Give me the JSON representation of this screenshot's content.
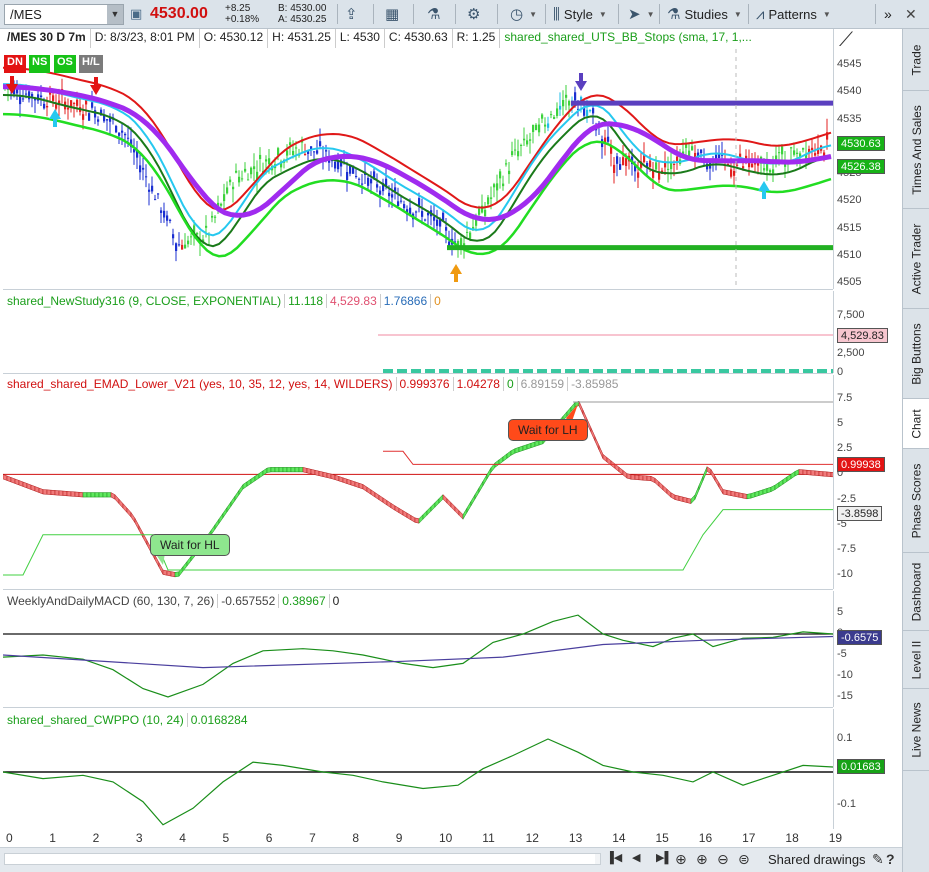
{
  "toolbar": {
    "symbol": "/MES",
    "last_price": "4530.00",
    "change": "+8.25",
    "change_pct": "+0.18%",
    "bid": "B: 4530.00",
    "ask": "A: 4530.25",
    "style_label": "Style",
    "studies_label": "Studies",
    "patterns_label": "Patterns"
  },
  "right_tabs": [
    "Trade",
    "Times And Sales",
    "Active Trader",
    "Big Buttons",
    "Chart",
    "Phase Scores",
    "Dashboard",
    "Level II",
    "Live News"
  ],
  "price_pane": {
    "header": [
      "/MES 30 D 7m",
      "D: 8/3/23, 8:01 PM",
      "O: 4530.12",
      "H: 4531.25",
      "L: 4530",
      "C: 4530.63",
      "R: 1.25",
      "shared_shared_UTS_BB_Stops (sma, 17, 1,..."
    ],
    "badges": [
      {
        "text": "DN",
        "color": "#e31313"
      },
      {
        "text": "NS",
        "color": "#17c217"
      },
      {
        "text": "OS",
        "color": "#17c217"
      },
      {
        "text": "H/L",
        "color": "#7b7b7b"
      }
    ],
    "ticks": [
      "4545",
      "4540",
      "4535",
      "4530",
      "4525",
      "4520",
      "4515",
      "4510",
      "4505"
    ],
    "price_labels": [
      {
        "text": "4530.63",
        "color": "#17b217",
        "value": 4530.63
      },
      {
        "text": "4526.38",
        "color": "#17b217",
        "value": 4526.38
      }
    ]
  },
  "study1": {
    "header": [
      "shared_NewStudy316 (9, CLOSE, EXPONENTIAL)",
      "11.118",
      "4,529.83",
      "1.76866",
      "0"
    ],
    "header_colors": [
      "#1a9e1a",
      "#1a9e1a",
      "#e05070",
      "#2a6db8",
      "#e09020"
    ],
    "ticks": [
      "7,500",
      "5,000",
      "2,500",
      "0"
    ],
    "label": {
      "text": "4,529.83",
      "color": "#f7c6cf",
      "value": 4529.83
    }
  },
  "study2": {
    "header": [
      "shared_shared_EMAD_Lower_V21 (yes, 10, 35, 12, yes, 14, WILDERS)",
      "0.999376",
      "1.04278",
      "0",
      "6.89159",
      "-3.85985"
    ],
    "header_colors": [
      "#d11010",
      "#d11010",
      "#d11010",
      "#1a9e1a",
      "#999999",
      "#999999"
    ],
    "ticks": [
      "7.5",
      "5",
      "2.5",
      "0",
      "-2.5",
      "-5",
      "-7.5",
      "-10"
    ],
    "labels": [
      {
        "text": "0.99938",
        "color": "#e31313",
        "value": 0.99938
      },
      {
        "text": "-3.8598",
        "color": "#f0f0f0",
        "value": -3.8598
      }
    ],
    "bubbles": [
      {
        "text": "Wait for LH",
        "color": "#ff4a1a"
      },
      {
        "text": "Wait for HL",
        "color": "#8ee68e"
      }
    ]
  },
  "study3": {
    "header": [
      "WeeklyAndDailyMACD (60, 130, 7, 26)",
      "-0.657552",
      "0.38967",
      "0"
    ],
    "header_colors": [
      "#444444",
      "#444444",
      "#1a9e1a",
      "#222222"
    ],
    "ticks": [
      "5",
      "0",
      "-5",
      "-10",
      "-15"
    ],
    "label": {
      "text": "-0.6575",
      "color": "#3b3b8e",
      "value": -0.6575
    }
  },
  "study4": {
    "header": [
      "shared_shared_CWPPO (10, 24)",
      "0.0168284"
    ],
    "header_colors": [
      "#1a9e1a",
      "#1a9e1a"
    ],
    "ticks": [
      "0.1",
      "0",
      "-0.1"
    ],
    "label": {
      "text": "0.01683",
      "color": "#17a217",
      "value": 0.01683
    }
  },
  "time_axis": [
    "0",
    "1",
    "2",
    "3",
    "4",
    "5",
    "6",
    "7",
    "8",
    "9",
    "10",
    "11",
    "12",
    "13",
    "14",
    "15",
    "16",
    "17",
    "18",
    "19"
  ],
  "bottom": {
    "shared_drawings": "Shared drawings"
  }
}
